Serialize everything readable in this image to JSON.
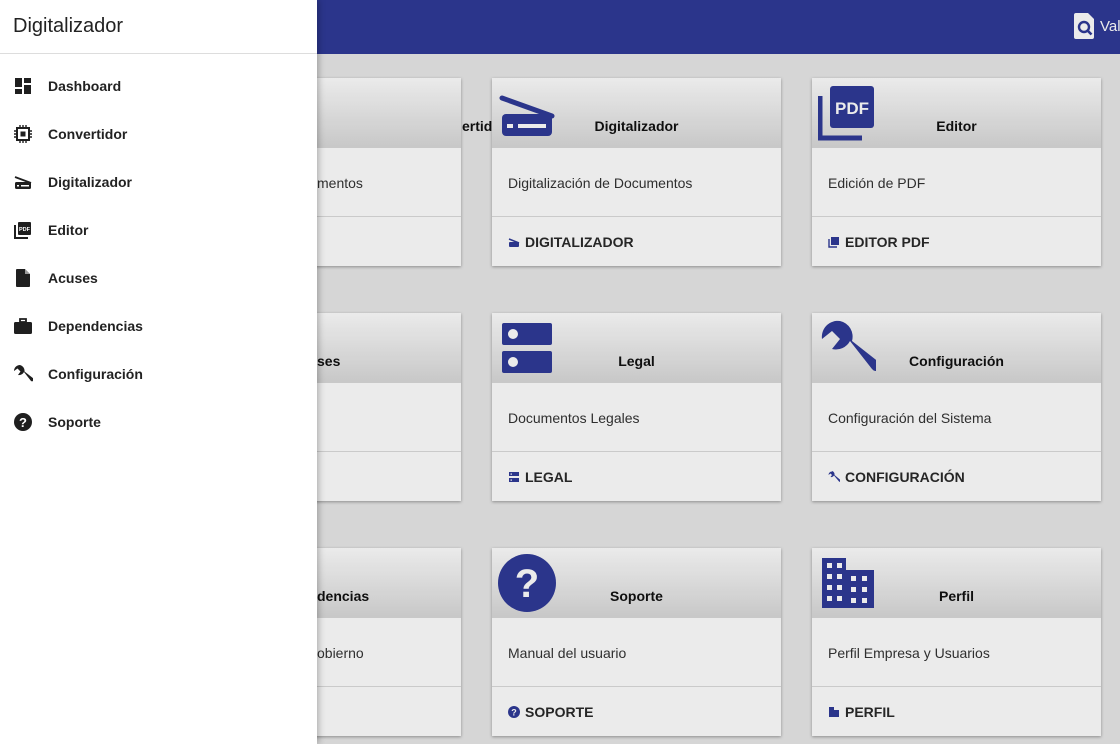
{
  "appbar": {
    "action_label": "Validar"
  },
  "drawer": {
    "title": "Digitalizador",
    "items": [
      {
        "label": "Dashboard",
        "icon": "dashboard-icon"
      },
      {
        "label": "Convertidor",
        "icon": "memory-chip-icon"
      },
      {
        "label": "Digitalizador",
        "icon": "scanner-icon"
      },
      {
        "label": "Editor",
        "icon": "pdf-icon"
      },
      {
        "label": "Acuses",
        "icon": "file-icon"
      },
      {
        "label": "Dependencias",
        "icon": "briefcase-icon"
      },
      {
        "label": "Configuración",
        "icon": "wrench-icon"
      },
      {
        "label": "Soporte",
        "icon": "help-circle-icon"
      }
    ]
  },
  "cards": [
    {
      "title": "Convertidor",
      "visible_title": "ertidor",
      "desc": "Conversión de Documentos",
      "visible_desc": "mentos",
      "action": "",
      "icon": "memory-chip-icon"
    },
    {
      "title": "Digitalizador",
      "desc": "Digitalización de Documentos",
      "action": "DIGITALIZADOR",
      "icon": "scanner-icon"
    },
    {
      "title": "Editor",
      "desc": "Edición de PDF",
      "action": "EDITOR PDF",
      "icon": "pdf-icon"
    },
    {
      "title": "Acuses",
      "visible_title": "ses",
      "desc": "",
      "action": "",
      "icon": "file-icon"
    },
    {
      "title": "Legal",
      "desc": "Documentos Legales",
      "action": "LEGAL",
      "icon": "dns-server-icon"
    },
    {
      "title": "Configuración",
      "desc": "Configuración del Sistema",
      "action": "CONFIGURACIÓN",
      "icon": "wrench-icon"
    },
    {
      "title": "Dependencias",
      "visible_title": "dencias",
      "desc": "Dependencias de Gobierno",
      "visible_desc": "obierno",
      "action": "",
      "icon": "briefcase-icon"
    },
    {
      "title": "Soporte",
      "desc": "Manual del usuario",
      "action": "SOPORTE",
      "icon": "help-circle-icon"
    },
    {
      "title": "Perfil",
      "desc": "Perfil Empresa y Usuarios",
      "action": "PERFIL",
      "icon": "building-icon"
    }
  ],
  "colors": {
    "appbar": "#2f3a97",
    "icon": "#2f3a97",
    "drawer_icon": "#1f1f1f"
  }
}
